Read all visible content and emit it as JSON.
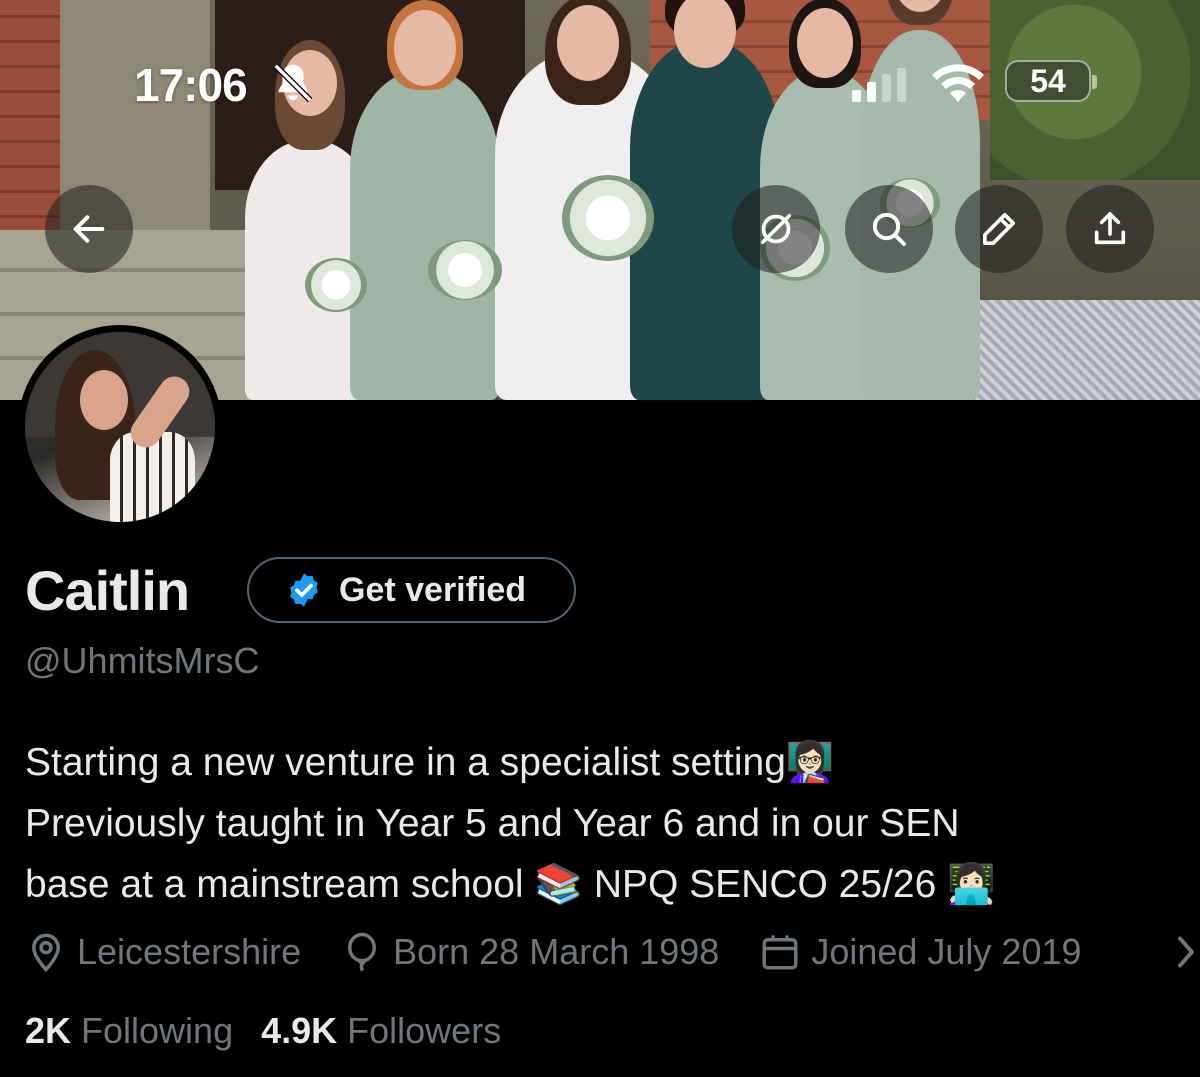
{
  "status_bar": {
    "time": "17:06",
    "battery": "54"
  },
  "header_buttons": {
    "back": "back-arrow-icon",
    "grok": "grok-icon",
    "search": "search-icon",
    "edit": "pencil-icon",
    "share": "share-icon"
  },
  "profile": {
    "name": "Caitlin",
    "verify_label": "Get verified",
    "handle": "@UhmitsMrsC",
    "bio_lines": [
      "Starting a new venture in a specialist setting👩🏻‍🏫",
      "Previously taught in Year 5 and Year 6 and in our SEN",
      "base at a mainstream school 📚 NPQ SENCO 25/26 👩🏻‍💻"
    ],
    "location": "Leicestershire",
    "born": "Born 28 March 1998",
    "joined": "Joined July 2019",
    "following_count": "2K",
    "following_label": "Following",
    "followers_count": "4.9K",
    "followers_label": "Followers"
  },
  "colors": {
    "background": "#000000",
    "text_primary": "#e7e9ea",
    "text_secondary": "#71767b",
    "verified_blue": "#1d9bf0",
    "pill_border": "#536471"
  }
}
